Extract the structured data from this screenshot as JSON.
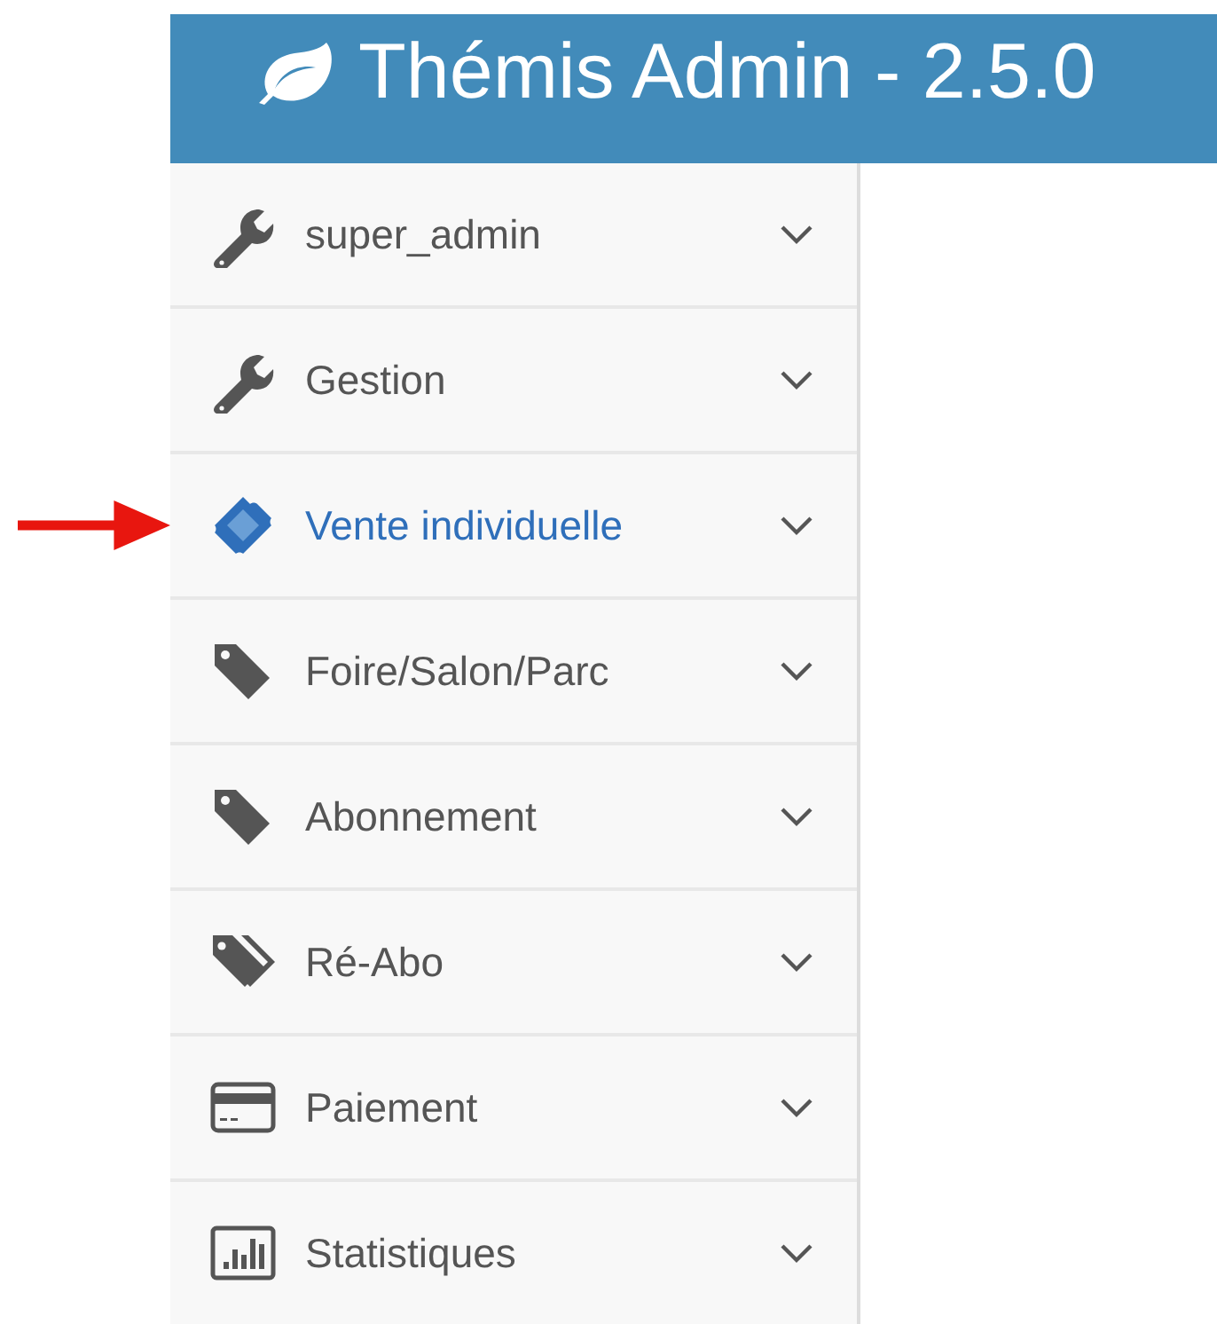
{
  "header": {
    "title": "Thémis Admin - 2.5.0"
  },
  "sidebar": {
    "items": [
      {
        "label": "super_admin",
        "kind": "wrench",
        "selected": false,
        "expanded": false
      },
      {
        "label": "Gestion",
        "kind": "wrench",
        "selected": false,
        "expanded": false
      },
      {
        "label": "Vente individuelle",
        "kind": "ticket",
        "selected": true,
        "expanded": false
      },
      {
        "label": "Foire/Salon/Parc",
        "kind": "tag",
        "selected": false,
        "expanded": false
      },
      {
        "label": "Abonnement",
        "kind": "tag",
        "selected": false,
        "expanded": false
      },
      {
        "label": "Ré-Abo",
        "kind": "tags",
        "selected": false,
        "expanded": false
      },
      {
        "label": "Paiement",
        "kind": "card",
        "selected": false,
        "expanded": false
      },
      {
        "label": "Statistiques",
        "kind": "chart",
        "selected": false,
        "expanded": false
      }
    ]
  }
}
